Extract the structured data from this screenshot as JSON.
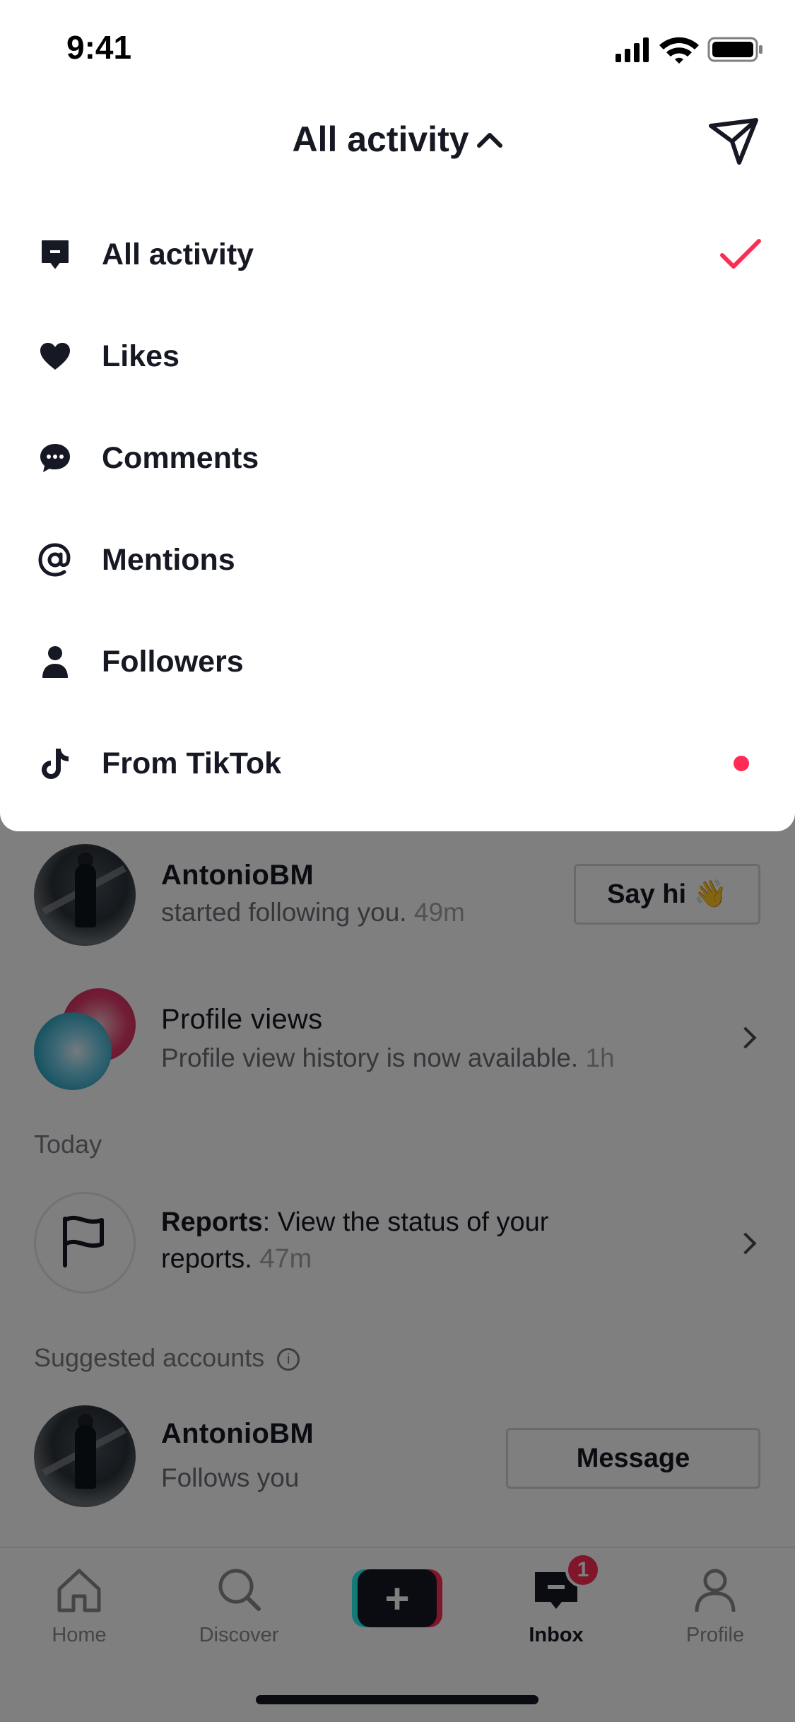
{
  "status_bar": {
    "time": "9:41"
  },
  "header": {
    "title": "All activity"
  },
  "menu": {
    "items": [
      {
        "label": "All activity",
        "icon": "comment-box-icon",
        "selected": true
      },
      {
        "label": "Likes",
        "icon": "heart-icon"
      },
      {
        "label": "Comments",
        "icon": "chat-bubble-icon"
      },
      {
        "label": "Mentions",
        "icon": "at-sign-icon"
      },
      {
        "label": "Followers",
        "icon": "person-icon"
      },
      {
        "label": "From TikTok",
        "icon": "tiktok-note-icon",
        "has_new": true
      }
    ]
  },
  "feed": {
    "follow_item": {
      "username": "AntonioBM",
      "text": "started following you.",
      "time": "49m",
      "action": "Say hi 👋"
    },
    "profile_views": {
      "title": "Profile views",
      "text": "Profile view history is now available.",
      "time": "1h"
    },
    "today_label": "Today",
    "reports": {
      "title": "Reports",
      "text": ": View the status of your",
      "text2": "reports.",
      "time": "47m"
    },
    "suggested_label": "Suggested accounts",
    "suggested": {
      "username": "AntonioBM",
      "text": "Follows you",
      "action": "Message"
    }
  },
  "tabbar": {
    "home": "Home",
    "discover": "Discover",
    "inbox": "Inbox",
    "profile": "Profile",
    "inbox_badge": "1"
  },
  "colors": {
    "accent": "#fe2c55",
    "text": "#161823",
    "cyan": "#25f4ee"
  }
}
